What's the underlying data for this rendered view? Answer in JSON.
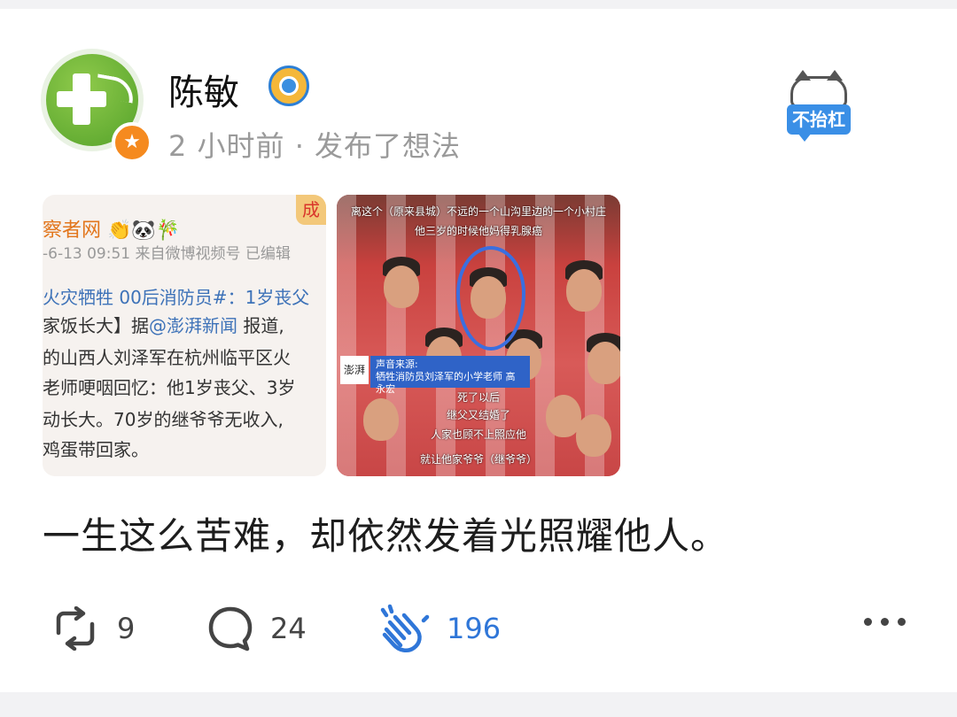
{
  "post": {
    "username": "陈敏",
    "meta": "2 小时前 · 发布了想法",
    "mascot_tag": "不抬杠",
    "text": "一生这么苦难，却依然发着光照耀他人。"
  },
  "image1": {
    "title": "察者网 👏🐼🎋",
    "date": "-6-13 09:51  来自微博视频号  已编辑",
    "corner": "成",
    "line1": "火灾牺牲 00后消防员#：1岁丧父",
    "line2_a": "家饭长大】据",
    "line2_link": "@澎湃新闻",
    "line2_b": " 报道,",
    "line3": "的山西人刘泽军在杭州临平区火",
    "line4": "老师哽咽回忆：他1岁丧父、3岁",
    "line5": "动长大。70岁的继爷爷无收入,",
    "line6": "鸡蛋带回家。"
  },
  "image2": {
    "caption1": "离这个（原来县城）不远的一个山沟里边的一个小村庄",
    "caption2": "他三岁的时候他妈得乳腺癌",
    "logo": "澎湃",
    "source_line1": "声音来源:",
    "source_line2": "牺牲消防员刘泽军的小学老师 高永宏",
    "caption3": "死了以后",
    "caption4": "继父又结婚了",
    "caption5": "人家也顾不上照应他",
    "caption6": "就让他家爷爷（继爷爷）"
  },
  "actions": {
    "repost_count": "9",
    "comment_count": "24",
    "like_count": "196"
  },
  "colors": {
    "accent": "#2f76d8",
    "verified": "#f58a1f",
    "meta_gray": "#9a9a9a"
  },
  "icons": [
    "repost-icon",
    "comment-icon",
    "clap-icon",
    "more-icon",
    "verified-star-icon",
    "user-badge-icon"
  ]
}
